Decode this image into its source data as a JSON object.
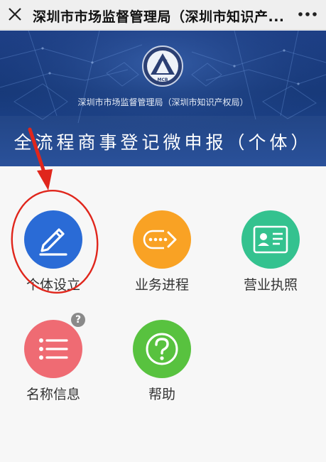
{
  "header": {
    "title": "深圳市市场监督管理局（深圳市知识产...",
    "close_icon": "close-icon",
    "more_icon": "more-icon"
  },
  "banner": {
    "emblem_text": "MCB",
    "subtitle": "深圳市市场监督管理局（深圳市知识产权局）",
    "title": "全流程商事登记微申报（个体）"
  },
  "tiles": [
    {
      "label": "个体设立",
      "icon": "pencil-icon",
      "color": "#2a6bd6"
    },
    {
      "label": "业务进程",
      "icon": "arrow-dots-icon",
      "color": "#f9a224"
    },
    {
      "label": "营业执照",
      "icon": "license-icon",
      "color": "#34c28f"
    },
    {
      "label": "名称信息",
      "icon": "list-icon",
      "color": "#ef6b73"
    },
    {
      "label": "帮助",
      "icon": "question-icon",
      "color": "#58c23f"
    }
  ],
  "badge": {
    "text": "?"
  },
  "annotation": {
    "color": "#e0261c"
  }
}
